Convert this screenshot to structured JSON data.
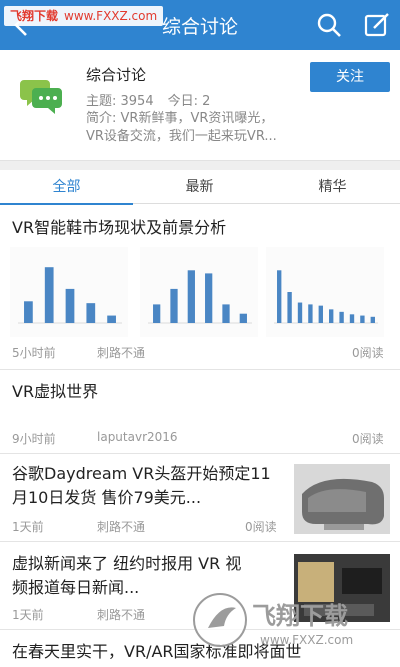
{
  "watermark": {
    "brand": "飞翔下载",
    "url": "www.FXXZ.com"
  },
  "topbar": {
    "title": "综合讨论"
  },
  "forum": {
    "name": "综合讨论",
    "topics_label": "主题: 3954",
    "today_label": "今日: 2",
    "desc_line1": "简介: VR新鲜事，VR资讯曝光，",
    "desc_line2": "VR设备交流，我们一起来玩VR...",
    "follow_label": "关注"
  },
  "tabs": [
    {
      "label": "全部"
    },
    {
      "label": "最新"
    },
    {
      "label": "精华"
    }
  ],
  "posts": [
    {
      "title": "VR智能鞋市场现状及前景分析",
      "time": "5小时前",
      "author": "刺路不通",
      "reads": "0阅读"
    },
    {
      "title": "VR虚拟世界",
      "time": "9小时前",
      "author": "laputavr2016",
      "reads": "0阅读"
    },
    {
      "title_line1": "谷歌Daydream VR头盔开始预定11",
      "title_line2": "月10日发货 售价79美元...",
      "time": "1天前",
      "author": "刺路不通",
      "reads": "0阅读"
    },
    {
      "title_line1": "虚拟新闻来了 纽约时报用 VR 视",
      "title_line2": "频报道每日新闻...",
      "time": "1天前",
      "author": "刺路不通"
    },
    {
      "title": "在春天里实干，VR/AR国家标准即将面世"
    }
  ],
  "mini_charts": [
    {
      "values": [
        0.35,
        0.9,
        0.55,
        0.32,
        0.12
      ]
    },
    {
      "values": [
        0.3,
        0.55,
        0.85,
        0.8,
        0.3,
        0.15
      ]
    },
    {
      "values": [
        0.85,
        0.5,
        0.33,
        0.3,
        0.28,
        0.22,
        0.18,
        0.14,
        0.12,
        0.1
      ]
    }
  ],
  "watermark_bottom": {
    "brand": "飞翔下载",
    "url": "www.FXXZ.com"
  },
  "colors": {
    "accent": "#2f84d0",
    "meta": "#999999"
  }
}
